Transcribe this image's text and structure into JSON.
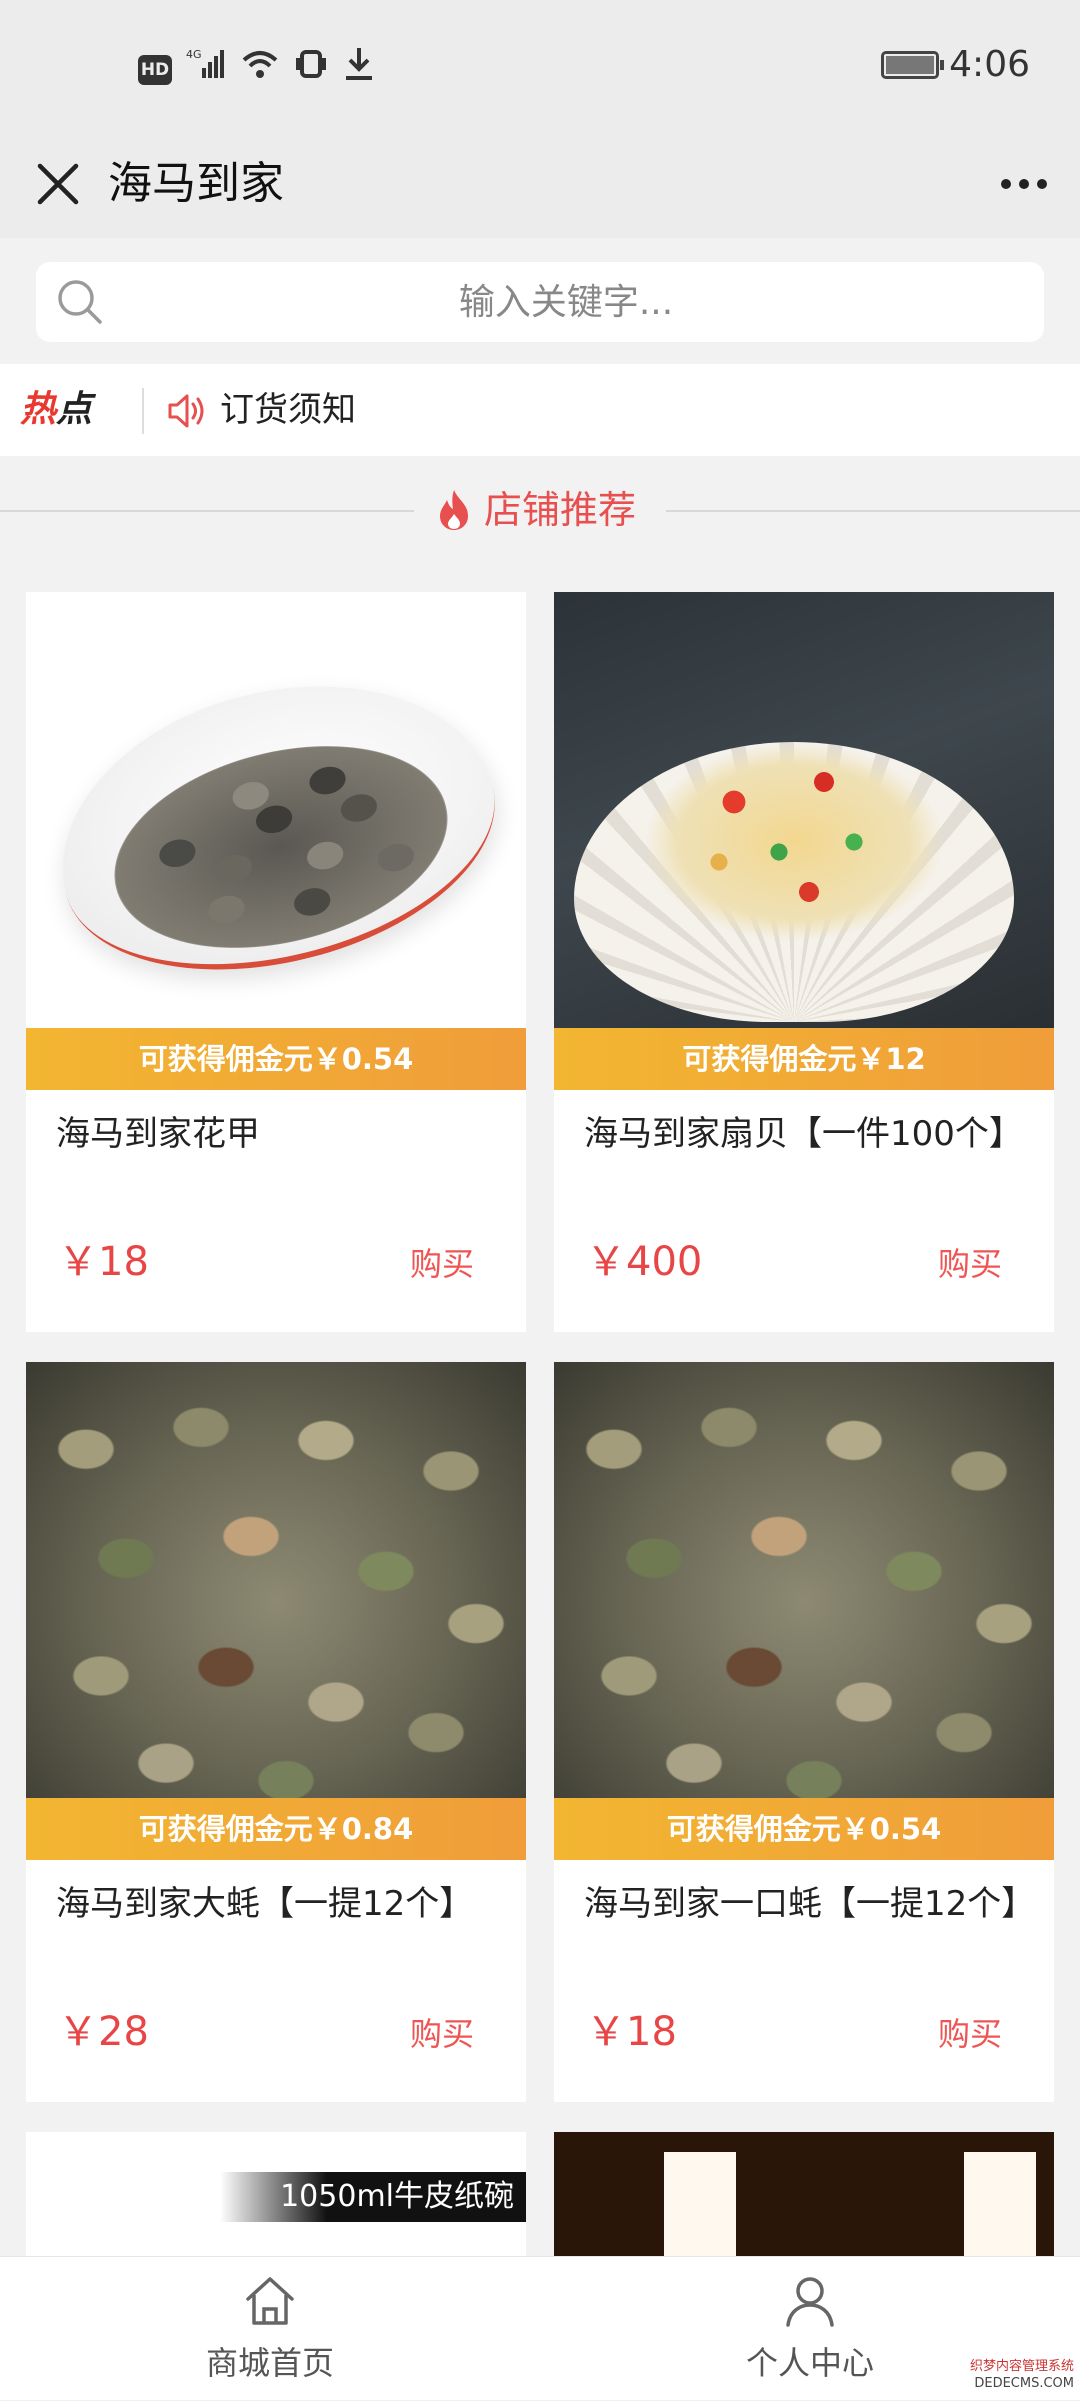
{
  "status_bar": {
    "hd": "HD",
    "network": "4G",
    "time": "4:06"
  },
  "header": {
    "title": "海马到家",
    "close_icon": "close-icon",
    "more_icon": "more-icon"
  },
  "search": {
    "placeholder": "输入关键字..."
  },
  "notice": {
    "hot_label_1": "热",
    "hot_label_2": "点",
    "text": "订货须知"
  },
  "section": {
    "title": "店铺推荐"
  },
  "products": [
    {
      "name": "海马到家花甲",
      "commission": "可获得佣金元￥0.54",
      "price": "￥18",
      "buy_label": "购买"
    },
    {
      "name": "海马到家扇贝【一件100个】",
      "commission": "可获得佣金元￥12",
      "price": "￥400",
      "buy_label": "购买"
    },
    {
      "name": "海马到家大蚝【一提12个】",
      "commission": "可获得佣金元￥0.84",
      "price": "￥28",
      "buy_label": "购买"
    },
    {
      "name": "海马到家一口蚝【一提12个】",
      "commission": "可获得佣金元￥0.54",
      "price": "￥18",
      "buy_label": "购买"
    }
  ],
  "partial_cards": [
    {
      "image_tag": "1050ml牛皮纸碗"
    }
  ],
  "tab_bar": {
    "home_label": "商城首页",
    "profile_label": "个人中心"
  },
  "watermark": {
    "line1": "织梦内容管理系统",
    "line2": "DEDECMS.COM"
  },
  "colors": {
    "accent_red": "#e84646",
    "commission_start": "#f2b631",
    "commission_end": "#f09d3a"
  }
}
